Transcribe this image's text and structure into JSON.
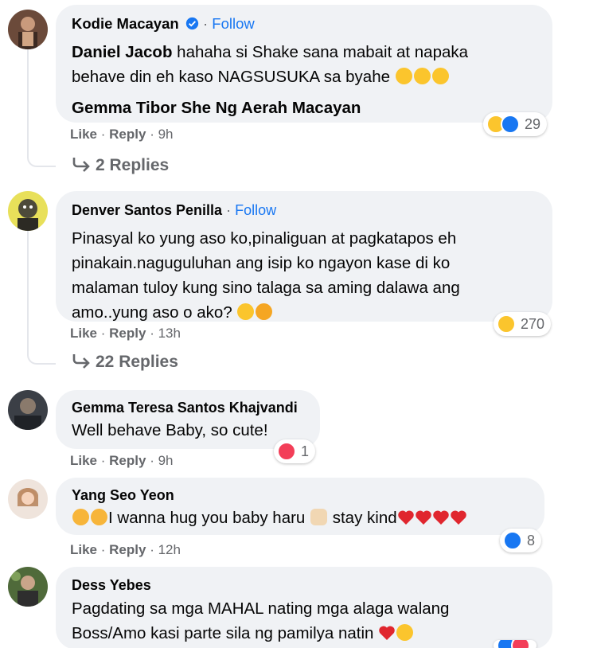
{
  "colors": {
    "link": "#1877f2",
    "muted": "#65676b",
    "bubble": "#f0f2f5",
    "heart": "#f33e58",
    "like": "#1877f2"
  },
  "comments": [
    {
      "author": "Kodie Macayan",
      "verified": true,
      "follow": "Follow",
      "mention1": "Daniel Jacob",
      "text1": "hahaha si Shake sana mabait at napaka",
      "text2": "behave din eh kaso NAGSUSUKA sa byahe",
      "line3": "Gemma Tibor She Ng Aerah Macayan",
      "like": "Like",
      "reply": "Reply",
      "time": "9h",
      "reaction_count": "29",
      "replies": "2 Replies"
    },
    {
      "author": "Denver Santos Penilla",
      "follow": "Follow",
      "text1": "Pinasyal ko yung aso ko,pinaliguan at pagkatapos eh",
      "text2": "pinakain.naguguluhan ang isip ko ngayon kase di ko",
      "text3": "malaman tuloy kung sino talaga sa aming dalawa ang",
      "text4": "amo..yung aso o ako?",
      "like": "Like",
      "reply": "Reply",
      "time": "13h",
      "reaction_count": "270",
      "replies": "22 Replies"
    },
    {
      "author": "Gemma Teresa Santos Khajvandi",
      "text1": "Well behave Baby, so cute!",
      "like": "Like",
      "reply": "Reply",
      "time": "9h",
      "reaction_count": "1"
    },
    {
      "author": "Yang Seo Yeon",
      "text1": "I wanna hug you baby haru",
      "text1b": "stay kind",
      "like": "Like",
      "reply": "Reply",
      "time": "12h",
      "reaction_count": "8"
    },
    {
      "author": "Dess Yebes",
      "text1": "Pagdating sa mga MAHAL nating mga alaga walang",
      "text2": "Boss/Amo kasi parte sila ng pamilya natin"
    }
  ]
}
